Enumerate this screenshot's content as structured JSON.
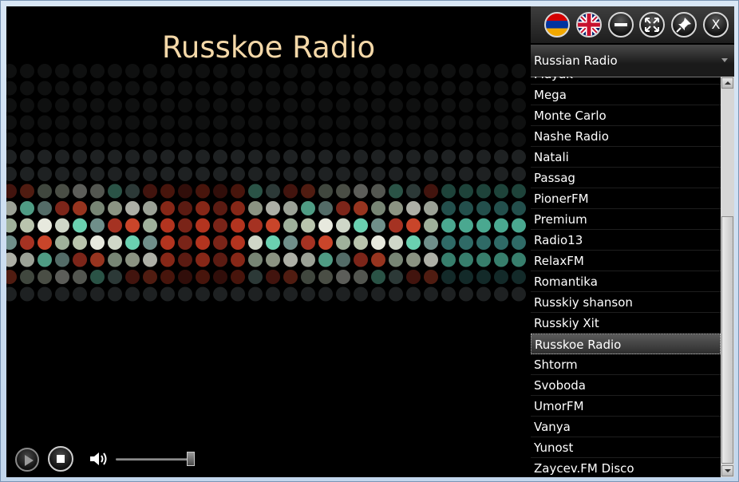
{
  "player": {
    "station_title": "Russkoe Radio"
  },
  "controls": {
    "play_icon": "play-icon",
    "stop_icon": "stop-icon",
    "volume_icon": "speaker-icon",
    "volume_level": 0.95
  },
  "toolbar": {
    "buttons": [
      {
        "name": "armenian-flag-icon"
      },
      {
        "name": "uk-flag-icon"
      },
      {
        "name": "minimize-icon"
      },
      {
        "name": "fullscreen-icon"
      },
      {
        "name": "pin-icon"
      },
      {
        "name": "close-icon",
        "label": "X"
      }
    ]
  },
  "category": {
    "selected": "Russian Radio"
  },
  "stations": {
    "partial_top": "Mayak",
    "items": [
      "Mega",
      "Monte Carlo",
      "Nashe Radio",
      "Natali",
      "Passag",
      "PionerFM",
      "Premium",
      "Radio13",
      "RelaxFM",
      "Romantika",
      "Russkiy shanson",
      "Russkiy Xit",
      "Russkoe Radio",
      "Shtorm",
      "Svoboda",
      "UmorFM",
      "Vanya",
      "Yunost",
      "Zaycev.FM Disco"
    ],
    "selected_index": 12
  },
  "colors": {
    "title": "#f4d8a8",
    "background": "#000000",
    "frame": "#cfe0f2"
  }
}
